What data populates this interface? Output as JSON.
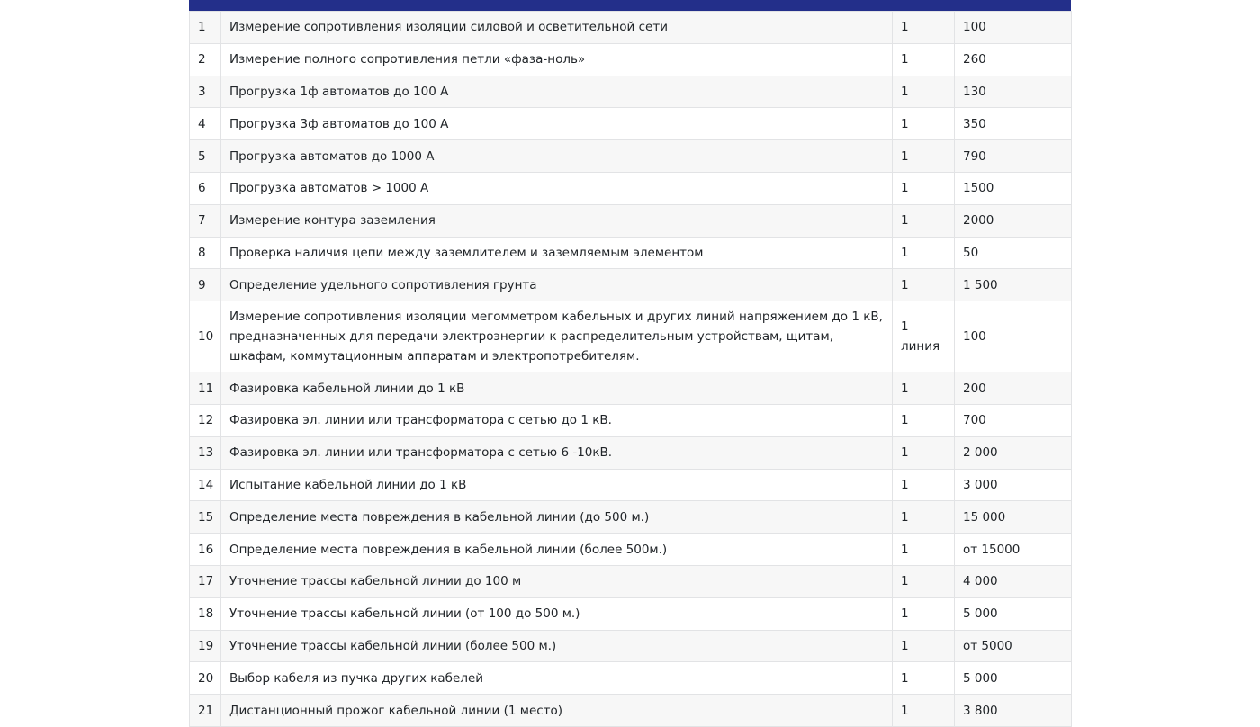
{
  "table": {
    "rows": [
      {
        "num": "1",
        "name": "Измерение сопротивления изоляции силовой и осветительной сети",
        "qty": "1",
        "price": "100"
      },
      {
        "num": "2",
        "name": "Измерение полного сопротивления петли «фаза-ноль»",
        "qty": "1",
        "price": "260"
      },
      {
        "num": "3",
        "name": "Прогрузка 1ф автоматов до 100 А",
        "qty": "1",
        "price": "130"
      },
      {
        "num": "4",
        "name": "Прогрузка 3ф автоматов до 100 А",
        "qty": "1",
        "price": "350"
      },
      {
        "num": "5",
        "name": "Прогрузка  автоматов до 1000 А",
        "qty": "1",
        "price": "790"
      },
      {
        "num": "6",
        "name": "Прогрузка  автоматов > 1000 А",
        "qty": "1",
        "price": "1500"
      },
      {
        "num": "7",
        "name": "Измерение контура заземления",
        "qty": "1",
        "price": "2000"
      },
      {
        "num": "8",
        "name": "Проверка наличия цепи между заземлителем и заземляемым элементом",
        "qty": "1",
        "price": "50"
      },
      {
        "num": "9",
        "name": "Определение удельного сопротивления грунта",
        "qty": "1",
        "price": "1 500"
      },
      {
        "num": "10",
        "name": "Измерение сопротивления изоляции мегомметром кабельных и других линий напряжением до 1 кВ, предназначенных для передачи электроэнергии к распределительным устройствам, щитам, шкафам, коммутационным аппаратам и электропотребителям.",
        "qty": "1 линия",
        "price": "100"
      },
      {
        "num": "11",
        "name": "Фазировка  кабельной линии до 1 кВ",
        "qty": "1",
        "price": "200"
      },
      {
        "num": "12",
        "name": "Фазировка эл. линии или трансформатора с сетью до 1 кВ.",
        "qty": "1",
        "price": "700"
      },
      {
        "num": "13",
        "name": "Фазировка эл. линии или трансформатора с сетью 6 -10кВ.",
        "qty": "1",
        "price": "2 000"
      },
      {
        "num": "14",
        "name": "Испытание кабельной линии до 1 кВ",
        "qty": "1",
        "price": "3 000"
      },
      {
        "num": "15",
        "name": "Определение места повреждения в кабельной линии (до 500 м.)",
        "qty": "1",
        "price": "15 000"
      },
      {
        "num": "16",
        "name": "Определение места повреждения в кабельной линии (более 500м.)",
        "qty": "1",
        "price": "от 15000"
      },
      {
        "num": "17",
        "name": "Уточнение трассы кабельной линии до 100 м",
        "qty": "1",
        "price": "4 000"
      },
      {
        "num": "18",
        "name": "Уточнение трассы кабельной линии (от 100 до 500 м.)",
        "qty": "1",
        "price": "5 000"
      },
      {
        "num": "19",
        "name": "Уточнение трассы кабельной линии (более 500 м.)",
        "qty": "1",
        "price": "от 5000"
      },
      {
        "num": "20",
        "name": "Выбор кабеля из пучка других кабелей",
        "qty": "1",
        "price": "5 000"
      },
      {
        "num": "21",
        "name": "Дистанционный прожог кабельной линии (1 место)",
        "qty": "1",
        "price": "3 800"
      }
    ]
  },
  "colors": {
    "header_bar": "#232f8a",
    "row_striped": "#f7f7f7",
    "border": "#e2e3e5"
  }
}
